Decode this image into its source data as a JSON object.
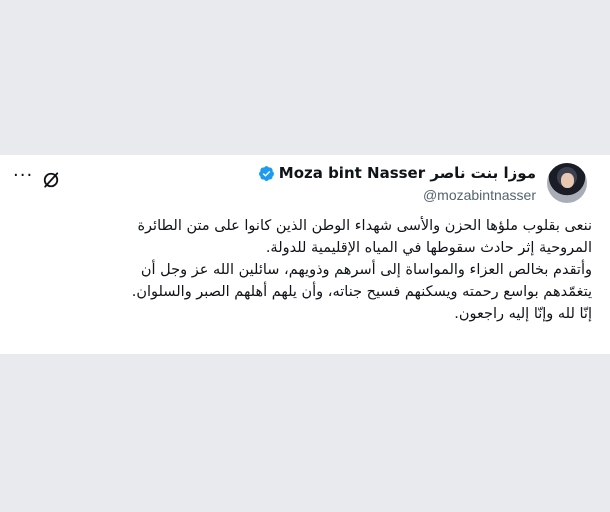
{
  "tweet": {
    "author": {
      "display_name": "Moza bint Nasser موزا بنت ناصر",
      "handle": "@mozabintnasser",
      "verified": true,
      "avatar_icon": "avatar"
    },
    "actions": {
      "grok_icon": "grok-icon",
      "more_icon": "more-icon",
      "more_glyph": "···"
    },
    "text_lines": [
      "ننعى بقلوب ملؤها الحزن والأسى شهداء الوطن الذين كانوا على متن الطائرة",
      "المروحية إثر حادث سقوطها في المياه الإقليمية للدولة.",
      "وأتقدم بخالص العزاء والمواساة إلى أسرهم وذويهم، سائلين الله عز وجل أن",
      "يتغمّدهم بواسع رحمته ويسكنهم فسيح جناته، وأن يلهم أهلهم الصبر والسلوان.",
      "إنّا لله وإنّا إليه راجعون."
    ]
  },
  "colors": {
    "background": "#e9eaee",
    "card": "#ffffff",
    "text": "#0f1419",
    "secondary_text": "#536471",
    "verified_blue": "#1d9bf0"
  }
}
